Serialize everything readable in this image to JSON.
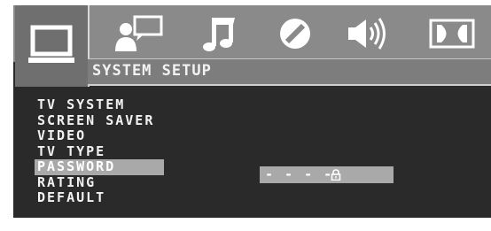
{
  "tabs": [
    {
      "name": "system",
      "icon": "monitor-icon",
      "active": true
    },
    {
      "name": "language",
      "icon": "user-speech-icon",
      "active": false
    },
    {
      "name": "audio",
      "icon": "music-note-icon",
      "active": false
    },
    {
      "name": "video",
      "icon": "circle-slash-icon",
      "active": false
    },
    {
      "name": "speaker",
      "icon": "speaker-volume-icon",
      "active": false
    },
    {
      "name": "dolby",
      "icon": "dolby-icon",
      "active": false
    }
  ],
  "header": {
    "title": "SYSTEM SETUP"
  },
  "menu": {
    "items": [
      "TV SYSTEM",
      "SCREEN SAVER",
      "VIDEO",
      "TV TYPE",
      "PASSWORD",
      "RATING",
      "DEFAULT"
    ],
    "selected_index": 4
  },
  "password": {
    "value": "- - - -",
    "lock_icon": "lock-icon"
  },
  "colors": {
    "background": "#2a2a2a",
    "tabbar": "#8a8a8a",
    "highlight": "#a9a9a9",
    "text": "#f2f2f2"
  }
}
